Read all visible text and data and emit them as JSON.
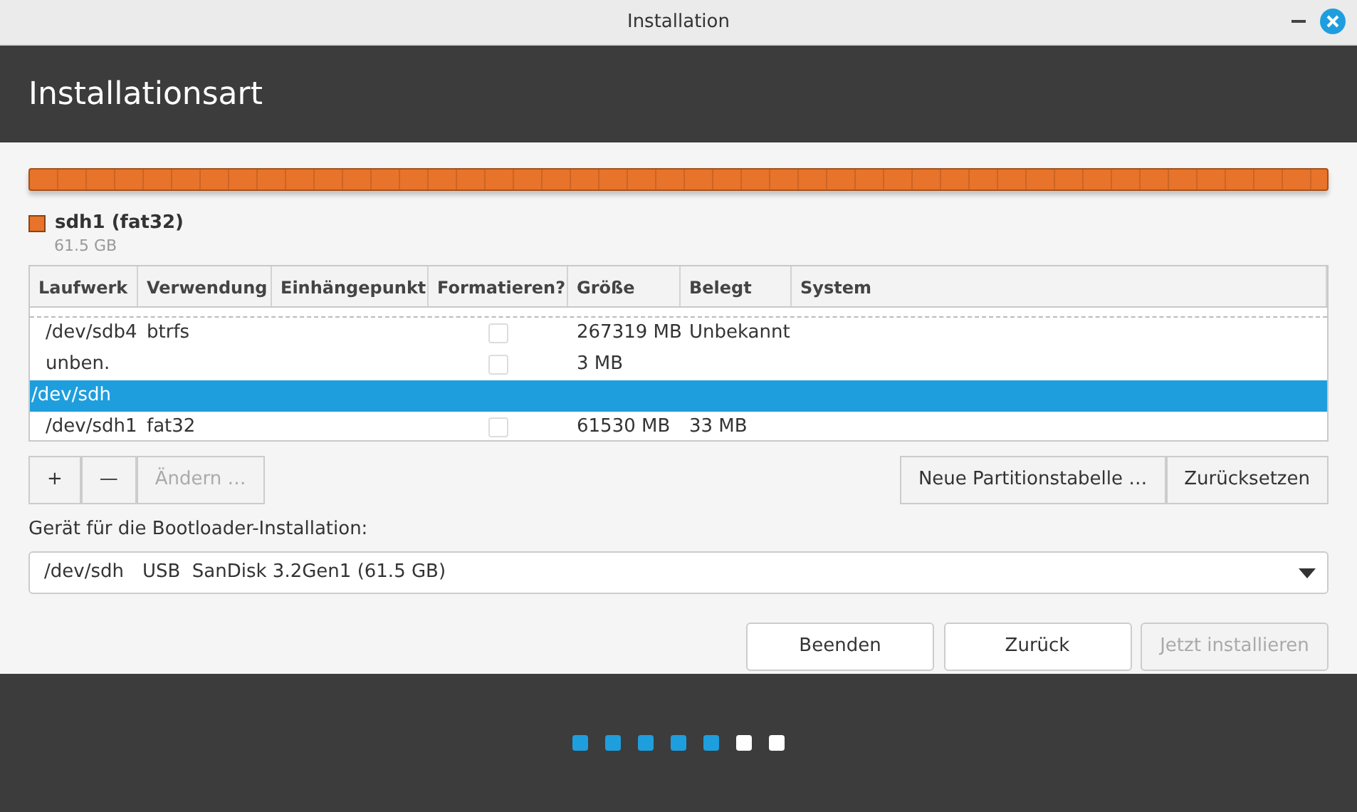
{
  "window": {
    "title": "Installation"
  },
  "header": {
    "title": "Installationsart"
  },
  "partition_bar": {
    "label": "sdh1 (fat32)",
    "size": "61.5 GB",
    "color": "#e8732a"
  },
  "table": {
    "columns": [
      "Laufwerk",
      "Verwendung",
      "Einhängepunkt",
      "Formatieren?",
      "Größe",
      "Belegt",
      "System"
    ],
    "rows": [
      {
        "kind": "partition",
        "selected": false,
        "device": "/dev/sdb4",
        "usage": "btrfs",
        "mount": "",
        "format_checked": false,
        "size": "267319 MB",
        "used": "Unbekannt",
        "system": ""
      },
      {
        "kind": "partition",
        "selected": false,
        "device": "unben.",
        "usage": "",
        "mount": "",
        "format_checked": false,
        "size": "3 MB",
        "used": "",
        "system": ""
      },
      {
        "kind": "disk",
        "selected": true,
        "device": "/dev/sdh"
      },
      {
        "kind": "partition",
        "selected": false,
        "device": "/dev/sdh1",
        "usage": "fat32",
        "mount": "",
        "format_checked": false,
        "size": "61530 MB",
        "used": "33 MB",
        "system": ""
      }
    ]
  },
  "toolbar": {
    "add": "+",
    "remove": "—",
    "change": {
      "label": "Ändern …",
      "disabled": true
    },
    "new_table": "Neue Partitionstabelle …",
    "reset": "Zurücksetzen"
  },
  "bootloader": {
    "label": "Gerät für die Bootloader-Installation:",
    "device": "/dev/sdh",
    "description": "USB  SanDisk 3.2Gen1 (61.5 GB)"
  },
  "buttons": [
    {
      "label": "Beenden",
      "disabled": false
    },
    {
      "label": "Zurück",
      "disabled": false
    },
    {
      "label": "Jetzt installieren",
      "disabled": true
    }
  ],
  "progress": [
    {
      "done": true
    },
    {
      "done": true
    },
    {
      "done": true
    },
    {
      "done": true
    },
    {
      "done": true
    },
    {
      "done": false
    },
    {
      "done": false
    }
  ]
}
